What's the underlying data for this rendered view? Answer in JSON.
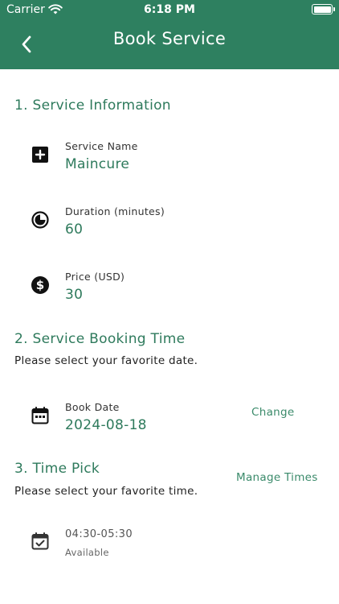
{
  "status_bar": {
    "carrier": "Carrier",
    "time": "6:18 PM",
    "battery_level": 1.0,
    "wifi_icon": "wifi-icon",
    "battery_icon": "battery-icon"
  },
  "nav": {
    "title": "Book Service",
    "back_icon": "chevron-left-icon",
    "background_color": "#2e8060"
  },
  "service_info": {
    "title": "1. Service Information",
    "name": {
      "label": "Service Name",
      "value": "Maincure",
      "icon": "plus-square-icon"
    },
    "duration": {
      "label": "Duration (minutes)",
      "value": "60",
      "icon": "clock-icon"
    },
    "price": {
      "label": "Price (USD)",
      "value": "30",
      "icon": "dollar-circle-icon"
    }
  },
  "booking_time": {
    "title": "2. Service Booking Time",
    "subtitle": "Please select your favorite date.",
    "date": {
      "label": "Book Date",
      "value": "2024-08-18",
      "icon": "calendar-icon"
    },
    "change_label": "Change"
  },
  "time_pick": {
    "title": "3. Time Pick",
    "subtitle": "Please select your favorite time.",
    "manage_label": "Manage Times",
    "slots": [
      {
        "time": "04:30-05:30",
        "status": "Available",
        "icon": "calendar-check-icon"
      }
    ]
  },
  "colors": {
    "accent": "#2e7a5c",
    "header": "#2e8060"
  }
}
